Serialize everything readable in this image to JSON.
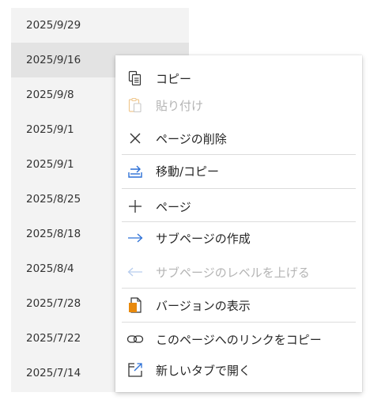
{
  "page_list": {
    "items": [
      {
        "date": "2025/9/29"
      },
      {
        "date": "2025/9/16"
      },
      {
        "date": "2025/9/8"
      },
      {
        "date": "2025/9/1"
      },
      {
        "date": "2025/9/1"
      },
      {
        "date": "2025/8/25"
      },
      {
        "date": "2025/8/18"
      },
      {
        "date": "2025/8/4"
      },
      {
        "date": "2025/7/28"
      },
      {
        "date": "2025/7/22"
      },
      {
        "date": "2025/7/14"
      }
    ],
    "selected_index": 1
  },
  "context_menu": {
    "items": [
      {
        "label": "コピー",
        "icon": "copy-icon",
        "enabled": true
      },
      {
        "label": "貼り付け",
        "icon": "paste-icon",
        "enabled": false
      },
      {
        "label": "ページの削除",
        "icon": "delete-icon",
        "enabled": true
      },
      {
        "label": "移動/コピー",
        "icon": "move-copy-icon",
        "enabled": true
      },
      {
        "label": "ページ",
        "icon": "plus-icon",
        "enabled": true
      },
      {
        "label": "サブページの作成",
        "icon": "arrow-right-icon",
        "enabled": true
      },
      {
        "label": "サブページのレベルを上げる",
        "icon": "arrow-left-icon",
        "enabled": false
      },
      {
        "label": "バージョンの表示",
        "icon": "versions-icon",
        "enabled": true
      },
      {
        "label": "このページへのリンクをコピー",
        "icon": "link-icon",
        "enabled": true
      },
      {
        "label": "新しいタブで開く",
        "icon": "open-new-tab-icon",
        "enabled": true
      }
    ]
  },
  "colors": {
    "accent_blue": "#2b6fd6",
    "accent_orange": "#e8890c",
    "disabled": "#b4b4b4"
  }
}
